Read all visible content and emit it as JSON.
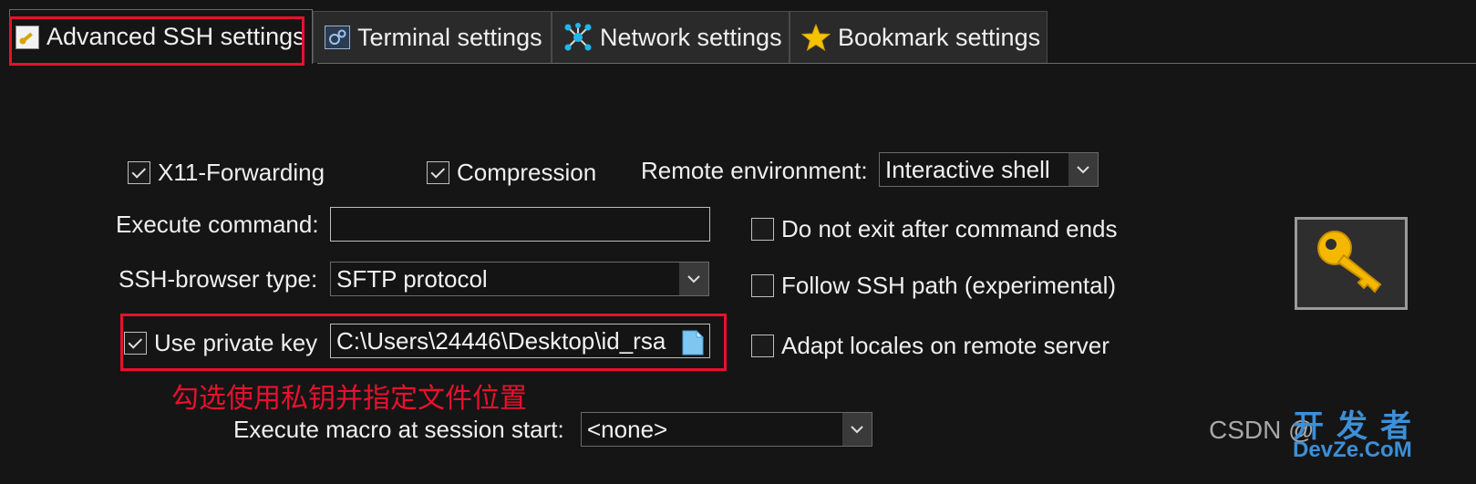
{
  "tabs": [
    {
      "label": "Advanced SSH settings",
      "icon": "wrench-icon",
      "active": true
    },
    {
      "label": "Terminal settings",
      "icon": "terminal-gear-icon",
      "active": false
    },
    {
      "label": "Network settings",
      "icon": "network-icon",
      "active": false
    },
    {
      "label": "Bookmark settings",
      "icon": "star-icon",
      "active": false
    }
  ],
  "form": {
    "x11_forwarding": {
      "label": "X11-Forwarding",
      "checked": true
    },
    "compression": {
      "label": "Compression",
      "checked": true
    },
    "remote_env": {
      "label": "Remote environment:",
      "value": "Interactive shell"
    },
    "execute_command": {
      "label": "Execute command:",
      "value": ""
    },
    "do_not_exit": {
      "label": "Do not exit after command ends",
      "checked": false
    },
    "browser_type": {
      "label": "SSH-browser type:",
      "value": "SFTP protocol"
    },
    "follow_path": {
      "label": "Follow SSH path (experimental)",
      "checked": false
    },
    "private_key": {
      "label": "Use private key",
      "checked": true,
      "value": "C:\\Users\\24446\\Desktop\\id_rsa"
    },
    "adapt_locales": {
      "label": "Adapt locales on remote server",
      "checked": false
    },
    "macro": {
      "label": "Execute macro at session start:",
      "value": "<none>"
    }
  },
  "key_button_icon": "key-icon",
  "annotation": "勾选使用私钥并指定文件位置",
  "watermark": {
    "csdn": "CSDN @",
    "brand_top": "开发者",
    "brand_bottom": "DevZe.CoM"
  },
  "colors": {
    "highlight": "#e8112d",
    "key_gold": "#f5b800"
  }
}
